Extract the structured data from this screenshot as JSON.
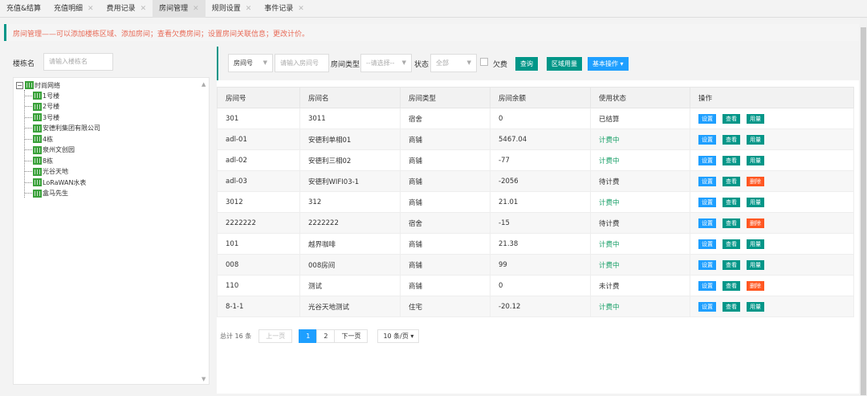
{
  "tabs": [
    {
      "label": "充值&结算",
      "closable": false,
      "active": false
    },
    {
      "label": "充值明细",
      "closable": true,
      "active": false
    },
    {
      "label": "费用记录",
      "closable": true,
      "active": false
    },
    {
      "label": "房间管理",
      "closable": true,
      "active": true
    },
    {
      "label": "规则设置",
      "closable": true,
      "active": false
    },
    {
      "label": "事件记录",
      "closable": true,
      "active": false
    }
  ],
  "info": "房间管理——可以添加楼栋区域、添加房间；查看欠费房间；设置房间关联信息；更改计价。",
  "left": {
    "label": "楼栋名",
    "placeholder": "请输入楼栋名",
    "tree": {
      "root": "时尚网络",
      "children": [
        "1号楼",
        "2号楼",
        "3号楼",
        "安德利集团有限公司",
        "4栋",
        "泉州文创园",
        "8栋",
        "光谷天地",
        "LoRaWAN水表",
        "盒马先生"
      ]
    }
  },
  "toolbar": {
    "field_select": "房间号",
    "room_placeholder": "请输入房间号",
    "type_label": "房间类型",
    "type_select": "--请选择--",
    "status_label": "状态",
    "status_select": "全部",
    "arrears_label": "欠费",
    "query": "查询",
    "area_usage": "区域用量",
    "basic_ops": "基本操作"
  },
  "table": {
    "headers": [
      "房间号",
      "房间名",
      "房间类型",
      "房间余额",
      "使用状态",
      "操作"
    ],
    "rows": [
      {
        "no": "301",
        "name": "3011",
        "type": "宿舍",
        "balance": "0",
        "status": "已结算",
        "green": false,
        "third": "用量"
      },
      {
        "no": "adl-01",
        "name": "安德利单相01",
        "type": "商铺",
        "balance": "5467.04",
        "status": "计费中",
        "green": true,
        "third": "用量"
      },
      {
        "no": "adl-02",
        "name": "安德利三相02",
        "type": "商铺",
        "balance": "-77",
        "status": "计费中",
        "green": true,
        "third": "用量"
      },
      {
        "no": "adl-03",
        "name": "安德利WIFI03-1",
        "type": "商铺",
        "balance": "-2056",
        "status": "待计费",
        "green": false,
        "third": "删除"
      },
      {
        "no": "3012",
        "name": "312",
        "type": "商铺",
        "balance": "21.01",
        "status": "计费中",
        "green": true,
        "third": "用量"
      },
      {
        "no": "2222222",
        "name": "2222222",
        "type": "宿舍",
        "balance": "-15",
        "status": "待计费",
        "green": false,
        "third": "删除"
      },
      {
        "no": "101",
        "name": "越界咖啡",
        "type": "商铺",
        "balance": "21.38",
        "status": "计费中",
        "green": true,
        "third": "用量"
      },
      {
        "no": "008",
        "name": "008房间",
        "type": "商铺",
        "balance": "99",
        "status": "计费中",
        "green": true,
        "third": "用量"
      },
      {
        "no": "110",
        "name": "测试",
        "type": "商铺",
        "balance": "0",
        "status": "未计费",
        "green": false,
        "third": "删除"
      },
      {
        "no": "8-1-1",
        "name": "光谷天地测试",
        "type": "住宅",
        "balance": "-20.12",
        "status": "计费中",
        "green": true,
        "third": "用量"
      }
    ],
    "op_set": "设置",
    "op_view": "查看"
  },
  "pager": {
    "total": "总计 16 条",
    "prev": "上一页",
    "pages": [
      "1",
      "2"
    ],
    "next": "下一页",
    "size": "10 条/页"
  }
}
